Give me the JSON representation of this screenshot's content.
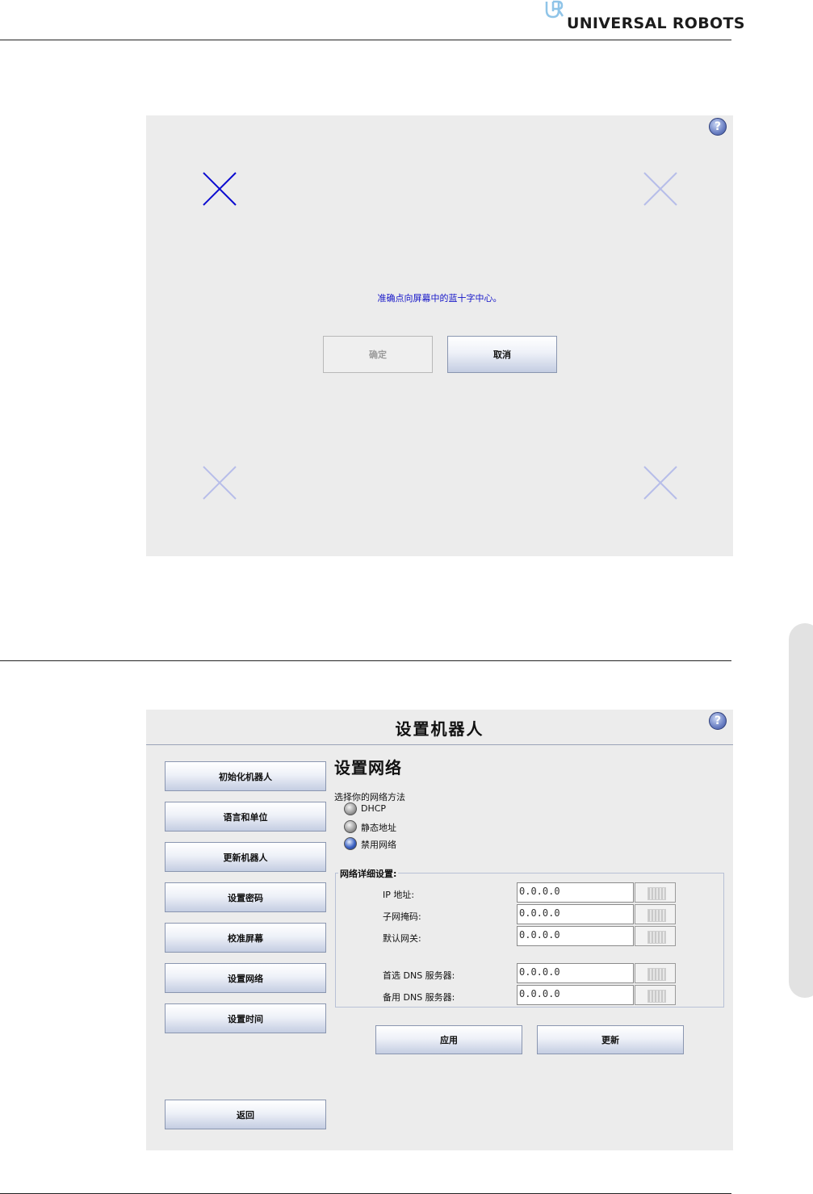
{
  "header": {
    "logo_text": "UNIVERSAL ROBOTS"
  },
  "calibration": {
    "help_icon": "?",
    "message": "准确点向屏幕中的蓝十字中心。",
    "ok_label": "确定",
    "cancel_label": "取消",
    "colors": {
      "active_cross": "#0b0bd0",
      "inactive_cross": "#b7bde9"
    }
  },
  "setup": {
    "help_icon": "?",
    "title": "设置机器人",
    "nav": [
      {
        "label": "初始化机器人"
      },
      {
        "label": "语言和单位"
      },
      {
        "label": "更新机器人"
      },
      {
        "label": "设置密码"
      },
      {
        "label": "校准屏幕"
      },
      {
        "label": "设置网络"
      },
      {
        "label": "设置时间"
      }
    ],
    "back_label": "返回",
    "network": {
      "section_title": "设置网络",
      "method_label": "选择你的网络方法",
      "methods": [
        {
          "label": "DHCP",
          "selected": false
        },
        {
          "label": "静态地址",
          "selected": false
        },
        {
          "label": "禁用网络",
          "selected": true
        }
      ],
      "details_legend": "网络详细设置:",
      "fields": [
        {
          "label": "IP 地址:",
          "value": "0.0.0.0"
        },
        {
          "label": "子网掩码:",
          "value": "0.0.0.0"
        },
        {
          "label": "默认网关:",
          "value": "0.0.0.0"
        },
        {
          "label": "首选 DNS 服务器:",
          "value": "0.0.0.0"
        },
        {
          "label": "备用 DNS 服务器:",
          "value": "0.0.0.0"
        }
      ],
      "apply_label": "应用",
      "update_label": "更新"
    }
  }
}
